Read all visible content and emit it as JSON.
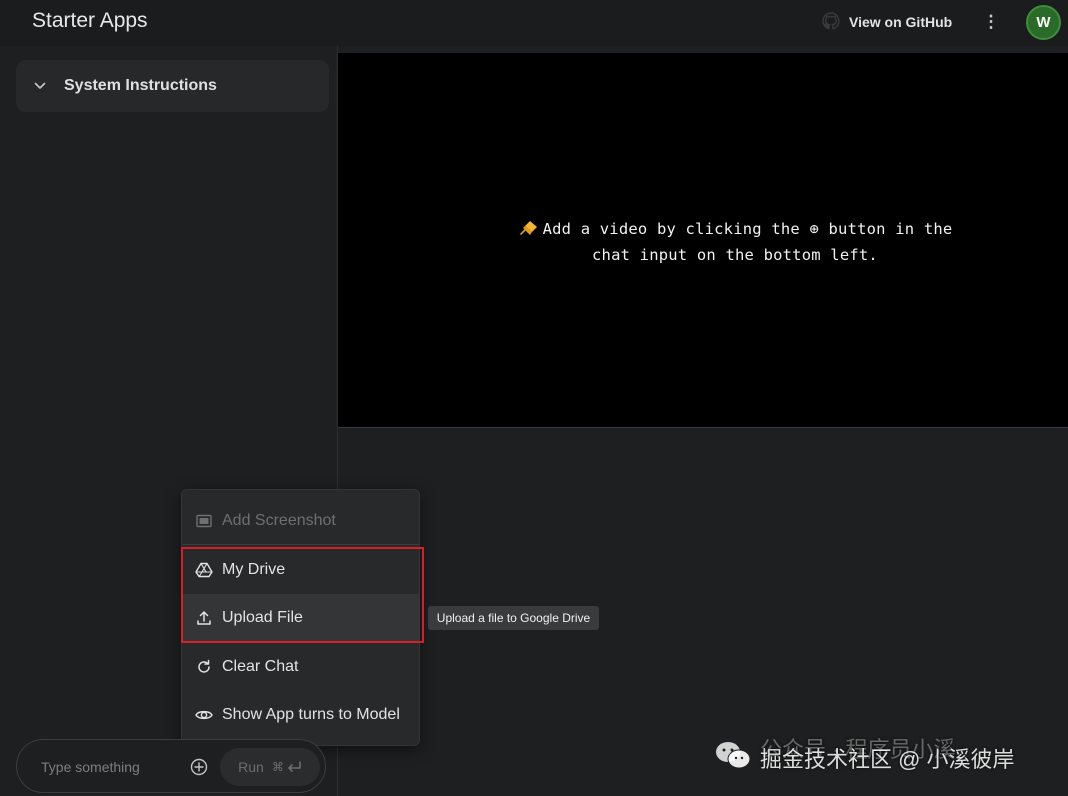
{
  "header": {
    "title": "Starter Apps",
    "github_label": "View on GitHub",
    "more_symbol": "⋮",
    "avatar_letter": "W",
    "avatar_color": "#2b6b2a"
  },
  "sidebar": {
    "system_instructions_label": "System Instructions"
  },
  "video_panel": {
    "message_line1": "Add a video by clicking the ⊕ button in the",
    "message_line2": "chat input on the bottom left."
  },
  "attach_menu": {
    "items": [
      {
        "label": "Add Screenshot",
        "icon": "screenshot-icon",
        "disabled": true
      },
      {
        "label": "My Drive",
        "icon": "drive-icon"
      },
      {
        "label": "Upload File",
        "icon": "upload-icon"
      },
      {
        "label": "Clear Chat",
        "icon": "refresh-icon"
      },
      {
        "label": "Show App turns to Model",
        "icon": "eye-icon"
      }
    ],
    "highlight_color": "#d61f26"
  },
  "tooltip": {
    "text": "Upload a file to Google Drive"
  },
  "chat_input": {
    "placeholder": "Type something",
    "run_label": "Run",
    "run_shortcut": "⌘"
  },
  "watermark": {
    "text_faint": "公众号 · 程序员小溪",
    "text": "掘金技术社区 @ 小溪彼岸"
  }
}
